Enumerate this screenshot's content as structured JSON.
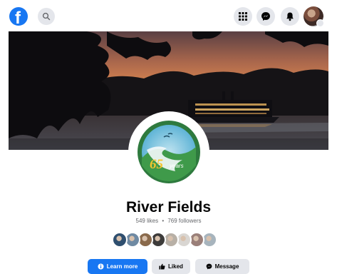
{
  "topbar": {
    "logo_letter": "f",
    "icons": [
      "facebook-logo",
      "search-icon",
      "menu-grid-icon",
      "messenger-icon",
      "bell-icon",
      "profile-avatar"
    ]
  },
  "page": {
    "name": "River Fields",
    "likes": "549 likes",
    "separator": "•",
    "followers": "769 followers",
    "logo_number": "65",
    "logo_word": "years"
  },
  "follower_faces": [
    {
      "color": "#2f4f6f"
    },
    {
      "color": "#6f8aa3"
    },
    {
      "color": "#8a6a4c"
    },
    {
      "color": "#3d3b3a"
    },
    {
      "color": "#b8b0a6"
    },
    {
      "color": "#d9d6d2"
    },
    {
      "color": "#9a7f79"
    },
    {
      "color": "#a7b4bd"
    }
  ],
  "actions": {
    "learn_more": "Learn more",
    "liked": "Liked",
    "message": "Message"
  },
  "colors": {
    "brand_blue": "#1877f2",
    "button_gray": "#e4e6eb",
    "secondary_text": "#65676b"
  }
}
